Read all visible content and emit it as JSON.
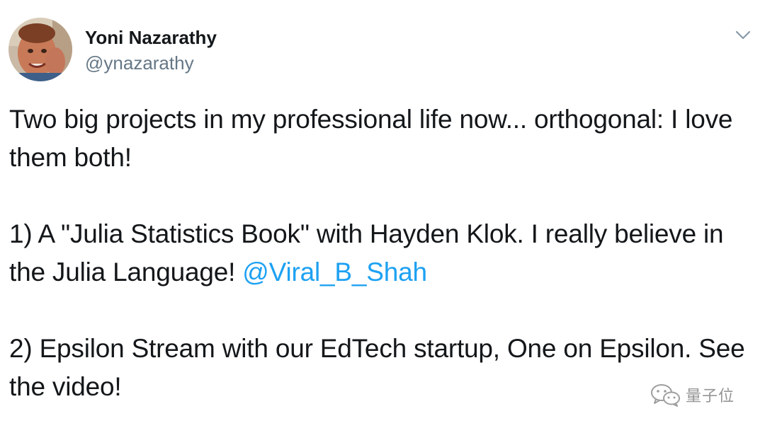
{
  "tweet": {
    "author": {
      "display_name": "Yoni Nazarathy",
      "handle": "@ynazarathy",
      "avatar_icon": "profile-photo"
    },
    "menu_icon": "chevron-down-icon",
    "paragraphs": [
      {
        "text": "Two big projects in my professional life now... orthogonal: I love them both!"
      },
      {
        "text": "1) A \"Julia Statistics Book\" with Hayden Klok. I really believe in the Julia Language! ",
        "mention": "@Viral_B_Shah"
      },
      {
        "text": "2) Epsilon Stream with our EdTech startup, One on Epsilon. See the video!"
      }
    ]
  },
  "watermark": {
    "icon": "wechat-icon",
    "text": "量子位"
  },
  "colors": {
    "text": "#14171a",
    "secondary": "#657786",
    "link": "#1da1f2",
    "watermark": "#8f8f8f"
  }
}
